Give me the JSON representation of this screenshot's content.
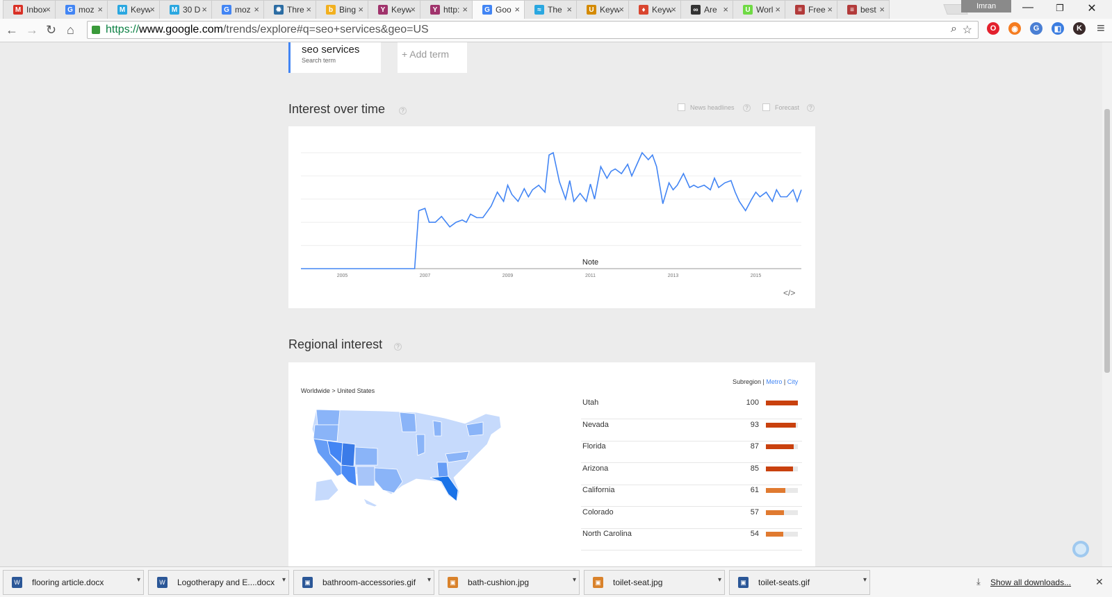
{
  "browser": {
    "tabs": [
      {
        "label": "Inbox",
        "favicon": "gmail-icon",
        "color": "#d93025",
        "glyph": "M"
      },
      {
        "label": "moz",
        "favicon": "google-icon",
        "color": "#4285f4",
        "glyph": "G"
      },
      {
        "label": "Keyw",
        "favicon": "m-icon",
        "color": "#2aa7e0",
        "glyph": "M"
      },
      {
        "label": "30 D",
        "favicon": "m-icon",
        "color": "#2aa7e0",
        "glyph": "M"
      },
      {
        "label": "moz",
        "favicon": "google-icon",
        "color": "#4285f4",
        "glyph": "G"
      },
      {
        "label": "Thre",
        "favicon": "gear-icon",
        "color": "#2b6ca3",
        "glyph": "✹"
      },
      {
        "label": "Bing",
        "favicon": "bing-icon",
        "color": "#f2b01e",
        "glyph": "b"
      },
      {
        "label": "Keyw",
        "favicon": "y-icon",
        "color": "#a0336c",
        "glyph": "Y"
      },
      {
        "label": "http:",
        "favicon": "y-icon",
        "color": "#a0336c",
        "glyph": "Y"
      },
      {
        "label": "Goo",
        "favicon": "google-icon",
        "color": "#4285f4",
        "glyph": "G",
        "active": true
      },
      {
        "label": "The",
        "favicon": "wave-icon",
        "color": "#2aa7e0",
        "glyph": "≈"
      },
      {
        "label": "Keyw",
        "favicon": "us-icon",
        "color": "#d48a00",
        "glyph": "U"
      },
      {
        "label": "Keyw",
        "favicon": "flame-icon",
        "color": "#d9452f",
        "glyph": "♦"
      },
      {
        "label": "Are",
        "favicon": "dots-icon",
        "color": "#333333",
        "glyph": "∞"
      },
      {
        "label": "Worl",
        "favicon": "upwork-icon",
        "color": "#6fda44",
        "glyph": "U"
      },
      {
        "label": "Free",
        "favicon": "doc-icon",
        "color": "#b23a3a",
        "glyph": "≡"
      },
      {
        "label": "best",
        "favicon": "doc-icon",
        "color": "#b23a3a",
        "glyph": "≡"
      }
    ],
    "profile_name": "Imran",
    "url": {
      "scheme": "https://",
      "domain": "www.google.com",
      "path": "/trends/explore#q=seo+services&geo=US"
    },
    "extensions": [
      {
        "name": "opera-icon",
        "glyph": "O",
        "color": "#e3212d"
      },
      {
        "name": "firefox-icon",
        "glyph": "◉",
        "color": "#f57c20"
      },
      {
        "name": "translate-icon",
        "glyph": "G",
        "color": "#4a7fd4"
      },
      {
        "name": "cast-icon",
        "glyph": "◧",
        "color": "#3b7de0"
      },
      {
        "name": "profile-k-icon",
        "glyph": "K",
        "color": "#3a2a2a"
      }
    ]
  },
  "page": {
    "search_term": "seo services",
    "search_term_sub": "Search term",
    "add_term": "+ Add term",
    "interest_title": "Interest over time",
    "help_glyph": "?",
    "news_headlines": "News headlines",
    "forecast": "Forecast",
    "note_label": "Note",
    "embed_glyph": "</>",
    "regional_title": "Regional interest",
    "breadcrumb": "Worldwide > United States",
    "subregion": "Subregion",
    "metro": "Metro",
    "city": "City",
    "regions": [
      {
        "name": "Utah",
        "value": 100
      },
      {
        "name": "Nevada",
        "value": 93
      },
      {
        "name": "Florida",
        "value": 87
      },
      {
        "name": "Arizona",
        "value": 85
      },
      {
        "name": "California",
        "value": 61
      },
      {
        "name": "Colorado",
        "value": 57
      },
      {
        "name": "North Carolina",
        "value": 54
      }
    ],
    "colors": {
      "line": "#4285f4",
      "bar_high": "#c9410e",
      "bar_mid": "#e07a30"
    }
  },
  "chart_data": {
    "type": "line",
    "x_tick_labels": [
      "2005",
      "2007",
      "2009",
      "2011",
      "2013",
      "2015"
    ],
    "xlim": [
      2004.0,
      2016.1
    ],
    "ylim": [
      0,
      100
    ],
    "grid": true,
    "series": [
      {
        "x": [
          2004.0,
          2004.5,
          2005.0,
          2005.5,
          2006.0,
          2006.5,
          2006.75,
          2006.85,
          2007.0,
          2007.1,
          2007.25,
          2007.4,
          2007.6,
          2007.75,
          2007.9,
          2008.0,
          2008.1,
          2008.25,
          2008.4,
          2008.5,
          2008.6,
          2008.75,
          2008.9,
          2009.0,
          2009.1,
          2009.25,
          2009.4,
          2009.5,
          2009.6,
          2009.75,
          2009.9,
          2010.0,
          2010.1,
          2010.25,
          2010.4,
          2010.5,
          2010.6,
          2010.75,
          2010.9,
          2011.0,
          2011.1,
          2011.25,
          2011.4,
          2011.5,
          2011.6,
          2011.75,
          2011.9,
          2012.0,
          2012.1,
          2012.25,
          2012.4,
          2012.5,
          2012.6,
          2012.75,
          2012.9,
          2013.0,
          2013.1,
          2013.25,
          2013.4,
          2013.5,
          2013.6,
          2013.75,
          2013.9,
          2014.0,
          2014.1,
          2014.25,
          2014.4,
          2014.5,
          2014.6,
          2014.75,
          2014.9,
          2015.0,
          2015.1,
          2015.25,
          2015.4,
          2015.5,
          2015.6,
          2015.75,
          2015.9,
          2016.0,
          2016.1
        ],
        "values": [
          0,
          0,
          0,
          0,
          0,
          0,
          0,
          50,
          52,
          40,
          40,
          45,
          36,
          40,
          42,
          40,
          47,
          44,
          44,
          49,
          54,
          66,
          58,
          72,
          64,
          58,
          69,
          62,
          68,
          72,
          66,
          98,
          100,
          75,
          60,
          76,
          58,
          65,
          58,
          73,
          60,
          88,
          78,
          84,
          86,
          82,
          90,
          80,
          88,
          100,
          94,
          98,
          88,
          56,
          74,
          68,
          72,
          82,
          70,
          72,
          70,
          72,
          68,
          78,
          70,
          74,
          76,
          66,
          58,
          50,
          60,
          66,
          62,
          66,
          58,
          68,
          62,
          62,
          68,
          58,
          68
        ]
      }
    ]
  },
  "downloads": {
    "items": [
      {
        "name": "flooring article.docx",
        "type": "W"
      },
      {
        "name": "Logotherapy and E....docx",
        "type": "W"
      },
      {
        "name": "bathroom-accessories.gif",
        "type": "▣"
      },
      {
        "name": "bath-cushion.jpg",
        "type": "▣"
      },
      {
        "name": "toilet-seat.jpg",
        "type": "▣"
      },
      {
        "name": "toilet-seats.gif",
        "type": "▣"
      }
    ],
    "show_all": "Show all downloads..."
  }
}
